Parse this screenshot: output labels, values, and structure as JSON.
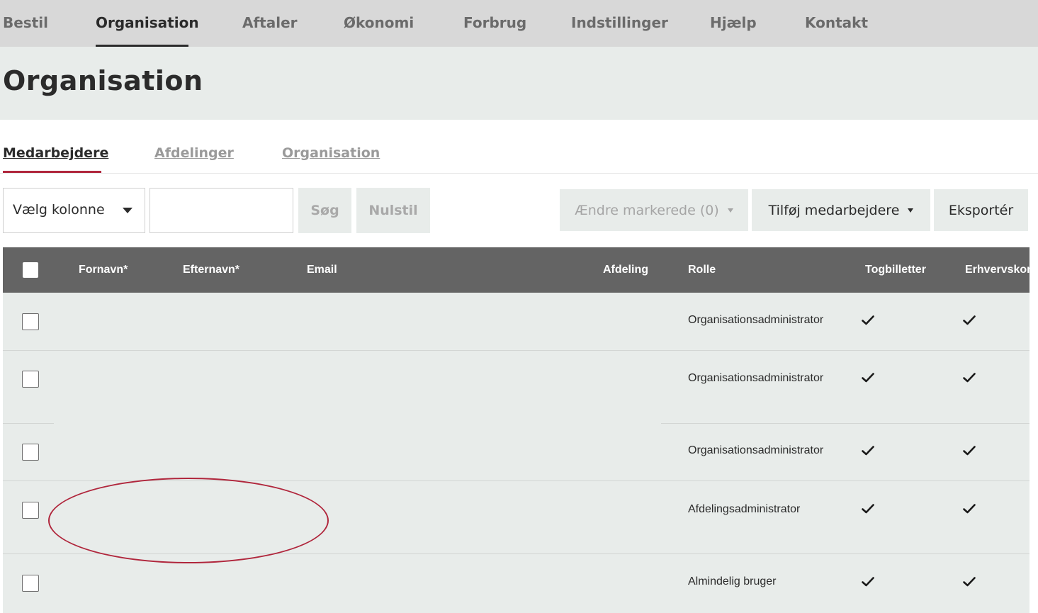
{
  "topnav": {
    "items": [
      {
        "label": "Bestil"
      },
      {
        "label": "Organisation"
      },
      {
        "label": "Aftaler"
      },
      {
        "label": "Økonomi"
      },
      {
        "label": "Forbrug"
      },
      {
        "label": "Indstillinger"
      },
      {
        "label": "Hjælp"
      },
      {
        "label": "Kontakt"
      }
    ],
    "active": "Organisation"
  },
  "page": {
    "title": "Organisation"
  },
  "subtabs": {
    "items": [
      {
        "label": "Medarbejdere"
      },
      {
        "label": "Afdelinger"
      },
      {
        "label": "Organisation"
      }
    ],
    "active": "Medarbejdere"
  },
  "toolbar": {
    "column_select": {
      "selected": "Vælg kolonne"
    },
    "search_input": {
      "value": "",
      "placeholder": ""
    },
    "search_label": "Søg",
    "reset_label": "Nulstil",
    "change_selected_label": "Ændre markerede (0)",
    "add_employees_label": "Tilføj medarbejdere",
    "export_label": "Eksportér"
  },
  "table": {
    "headers": {
      "first_name": "Fornavn*",
      "last_name": "Efternavn*",
      "email": "Email",
      "department": "Afdeling",
      "role": "Rolle",
      "train_tickets": "Togbilletter",
      "business_card": "Erhvervskor"
    },
    "rows": [
      {
        "first_name": "",
        "last_name": "",
        "email": "",
        "department": "",
        "role": "Organisationsadministrator",
        "train_tickets": true,
        "business_card": true
      },
      {
        "first_name": "",
        "last_name": "",
        "email": "",
        "department": "",
        "role": "Organisationsadministrator",
        "train_tickets": true,
        "business_card": true
      },
      {
        "first_name": "",
        "last_name": "",
        "email": "",
        "department": "",
        "role": "Organisationsadministrator",
        "train_tickets": true,
        "business_card": true
      },
      {
        "first_name": "",
        "last_name": "",
        "email": "",
        "department": "",
        "role": "Afdelingsadministrator",
        "train_tickets": true,
        "business_card": true
      },
      {
        "first_name": "",
        "last_name": "",
        "email": "",
        "department": "",
        "role": "Almindelig bruger",
        "train_tickets": true,
        "business_card": true
      }
    ]
  },
  "colors": {
    "accent": "#b0263c",
    "nav_bg": "#d8d8d8",
    "header_bg": "#e8ecea",
    "table_header_bg": "#646464"
  },
  "icons": {
    "caret": "chevron-down-icon",
    "check": "checkmark-icon"
  }
}
